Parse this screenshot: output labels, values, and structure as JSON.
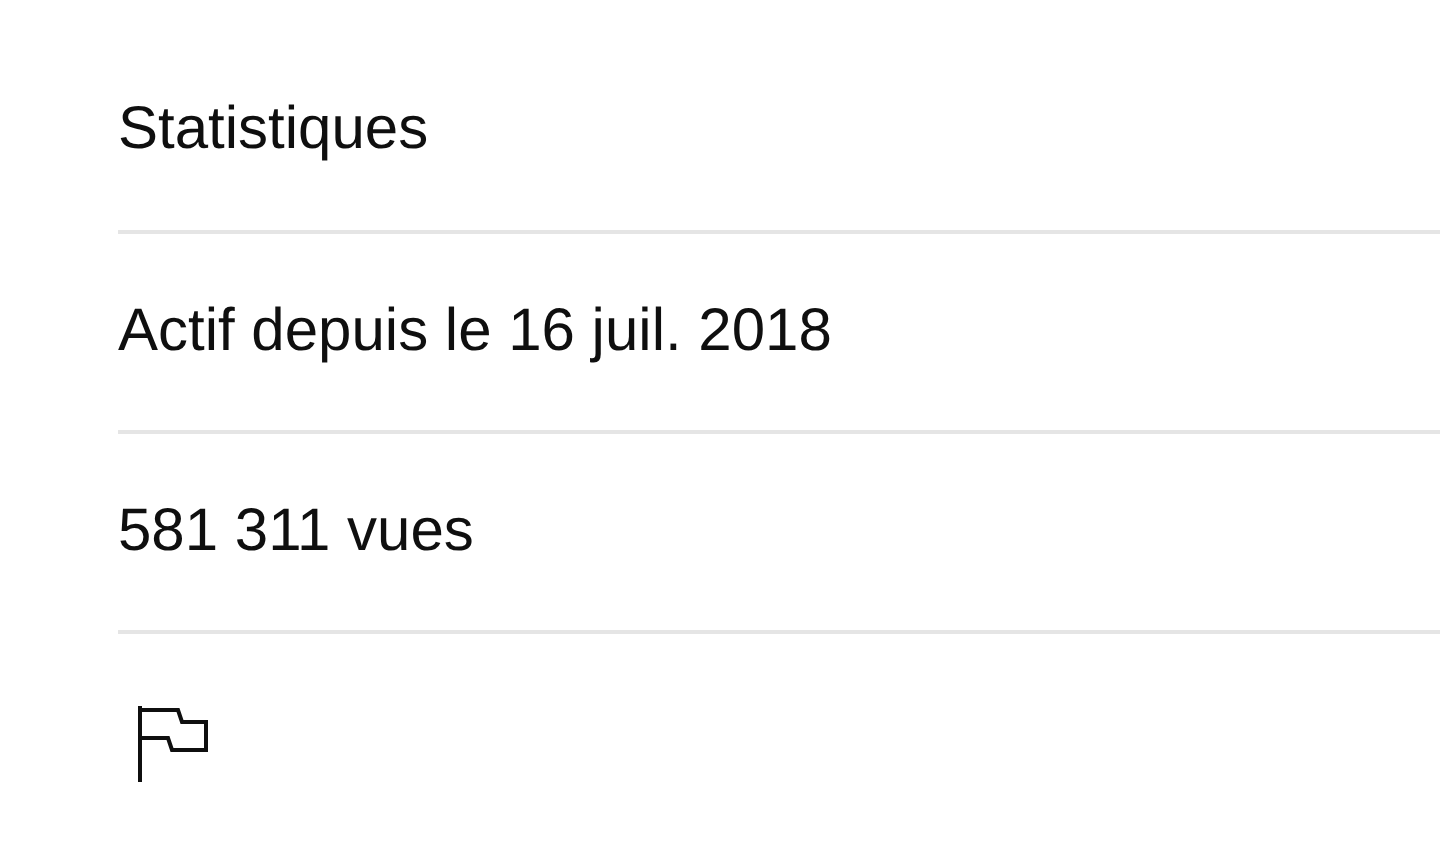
{
  "section": {
    "title": "Statistiques"
  },
  "stats": [
    "Actif depuis le 16 juil. 2018",
    "581 311 vues"
  ]
}
